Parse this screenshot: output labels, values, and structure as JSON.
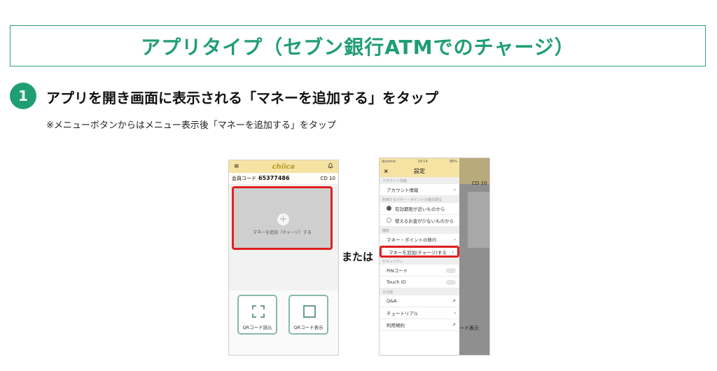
{
  "title": "アプリタイプ（セブン銀行ATMでのチャージ）",
  "step": {
    "number": "1",
    "heading": "アプリを開き画面に表示される「マネーを追加する」をタップ",
    "note": "※メニューボタンからはメニュー表示後「マネーを追加する」をタップ"
  },
  "phone1": {
    "menu_icon": "≡",
    "logo": "chiica",
    "bell_icon": "bell-icon",
    "member_code_label": "会員コード",
    "member_code": "65377486",
    "cd_label": "CD 10",
    "add_money_label": "マネーを追加（チャージ）する",
    "qr_scan_label": "QRコード読込",
    "qr_show_label": "QRコード表示"
  },
  "or_label": "または",
  "phone2": {
    "status_left": "docomo",
    "status_time": "14:14",
    "status_right": "98%",
    "close": "×",
    "settings_title": "設定",
    "section_account": "アカウント情報",
    "account_info": "アカウント情報",
    "section_money_order": "利用するマネー・ポイントの優先順位",
    "option_expiry": "有効期限が近いものから",
    "option_balance": "使えるお金が少ないものから",
    "section_other": "機能",
    "money_transfer": "マネー・ポイントの移行",
    "add_money": "マネーを追加(チャージ)する",
    "section_security": "セキュリティ",
    "pin_code": "PINコード",
    "touch_id": "Touch ID",
    "section_misc": "その他",
    "qa": "Q&A",
    "tutorial": "チュートリアル",
    "terms": "利用規約",
    "bg_cd": "CD 10",
    "bg_show": "ード表示"
  }
}
